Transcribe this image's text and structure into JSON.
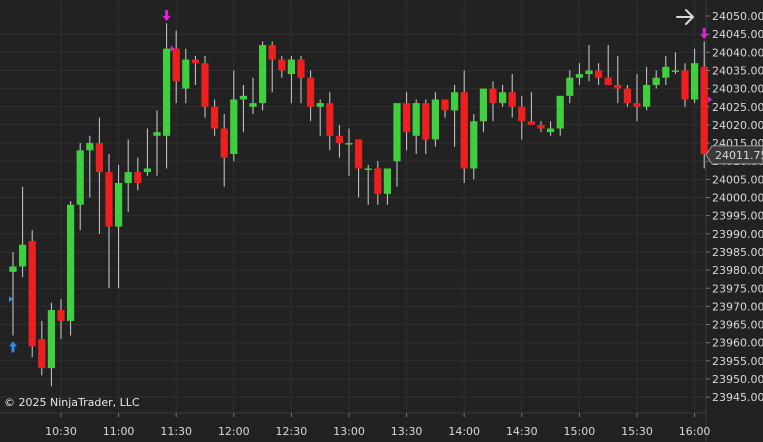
{
  "copyright": "© 2025 NinjaTrader, LLC",
  "colors": {
    "background": "#222223",
    "grid": "#2f2f31",
    "up": "#3fcf3f",
    "down": "#ee1f1f",
    "wick": "#cfcfcf",
    "marker_sell": "#e020e0",
    "marker_buy": "#2f8fe8",
    "price_tag_bg": "#3a3a3c",
    "arrow": "#d8d8d8"
  },
  "current_price": "24011.75",
  "nav_arrow_icon": "arrow-right-icon",
  "chart_data": {
    "type": "candlestick",
    "y_axis_ticks": [
      "24050.00",
      "24045.00",
      "24040.00",
      "24035.00",
      "24030.00",
      "24025.00",
      "24020.00",
      "24015.00",
      "24010.00",
      "24005.00",
      "24000.00",
      "23995.00",
      "23990.00",
      "23985.00",
      "23980.00",
      "23975.00",
      "23970.00",
      "23965.00",
      "23960.00",
      "23955.00",
      "23950.00",
      "23945.00"
    ],
    "ylim": [
      23943,
      24052
    ],
    "x_axis_ticks": [
      "10:30",
      "11:00",
      "11:30",
      "12:00",
      "12:30",
      "13:00",
      "13:30",
      "14:00",
      "14:30",
      "15:00",
      "15:30",
      "16:00"
    ],
    "candles": [
      {
        "o": 23979.5,
        "h": 23985,
        "l": 23962,
        "c": 23981
      },
      {
        "o": 23981,
        "h": 24003,
        "l": 23978,
        "c": 23987
      },
      {
        "o": 23988,
        "h": 23991,
        "l": 23956,
        "c": 23959
      },
      {
        "o": 23961,
        "h": 23966,
        "l": 23951,
        "c": 23953
      },
      {
        "o": 23953,
        "h": 23971,
        "l": 23948,
        "c": 23969
      },
      {
        "o": 23969,
        "h": 23972,
        "l": 23961,
        "c": 23966
      },
      {
        "o": 23966,
        "h": 23999,
        "l": 23962,
        "c": 23998
      },
      {
        "o": 23998,
        "h": 24015,
        "l": 23991,
        "c": 24013
      },
      {
        "o": 24013,
        "h": 24017,
        "l": 24000,
        "c": 24015
      },
      {
        "o": 24015,
        "h": 24022,
        "l": 23990,
        "c": 24007
      },
      {
        "o": 24007,
        "h": 24012,
        "l": 23975,
        "c": 23992
      },
      {
        "o": 23992,
        "h": 24009,
        "l": 23975,
        "c": 24004
      },
      {
        "o": 24004,
        "h": 24016,
        "l": 23996,
        "c": 24007
      },
      {
        "o": 24007,
        "h": 24011,
        "l": 24002,
        "c": 24004
      },
      {
        "o": 24007,
        "h": 24019,
        "l": 24006,
        "c": 24008
      },
      {
        "o": 24017,
        "h": 24024,
        "l": 24006,
        "c": 24018
      },
      {
        "o": 24017,
        "h": 24048,
        "l": 24008,
        "c": 24041
      },
      {
        "o": 24041,
        "h": 24046,
        "l": 24026,
        "c": 24032
      },
      {
        "o": 24030,
        "h": 24041,
        "l": 24026,
        "c": 24038
      },
      {
        "o": 24038,
        "h": 24039,
        "l": 24031,
        "c": 24037
      },
      {
        "o": 24037,
        "h": 24039,
        "l": 24022,
        "c": 24025
      },
      {
        "o": 24025,
        "h": 24027,
        "l": 24017,
        "c": 24019
      },
      {
        "o": 24019,
        "h": 24023,
        "l": 24003,
        "c": 24011
      },
      {
        "o": 24012,
        "h": 24035,
        "l": 24010,
        "c": 24027
      },
      {
        "o": 24027,
        "h": 24031,
        "l": 24018,
        "c": 24028
      },
      {
        "o": 24025,
        "h": 24033,
        "l": 24023,
        "c": 24026
      },
      {
        "o": 24026,
        "h": 24043,
        "l": 24024,
        "c": 24042
      },
      {
        "o": 24042,
        "h": 24043,
        "l": 24029,
        "c": 24038
      },
      {
        "o": 24038,
        "h": 24039,
        "l": 24033,
        "c": 24035
      },
      {
        "o": 24034,
        "h": 24039,
        "l": 24026,
        "c": 24038
      },
      {
        "o": 24038,
        "h": 24039,
        "l": 24026,
        "c": 24033
      },
      {
        "o": 24033,
        "h": 24035,
        "l": 24021,
        "c": 24025
      },
      {
        "o": 24025,
        "h": 24027,
        "l": 24017,
        "c": 24026
      },
      {
        "o": 24026,
        "h": 24029,
        "l": 24013,
        "c": 24017
      },
      {
        "o": 24017,
        "h": 24020,
        "l": 24011,
        "c": 24015
      },
      {
        "o": 24015,
        "h": 24019,
        "l": 24006,
        "c": 24015
      },
      {
        "o": 24016,
        "h": 24016,
        "l": 24000,
        "c": 24008
      },
      {
        "o": 24008,
        "h": 24009,
        "l": 23998,
        "c": 24008
      },
      {
        "o": 24008,
        "h": 24010,
        "l": 23998,
        "c": 24001
      },
      {
        "o": 24001,
        "h": 24007,
        "l": 23998,
        "c": 24008
      },
      {
        "o": 24010,
        "h": 24015,
        "l": 24003,
        "c": 24026
      },
      {
        "o": 24026,
        "h": 24029,
        "l": 24013,
        "c": 24018
      },
      {
        "o": 24017,
        "h": 24027,
        "l": 24012,
        "c": 24026
      },
      {
        "o": 24026,
        "h": 24027,
        "l": 24012,
        "c": 24016
      },
      {
        "o": 24016,
        "h": 24029,
        "l": 24014,
        "c": 24027
      },
      {
        "o": 24027,
        "h": 24027,
        "l": 24022,
        "c": 24024
      },
      {
        "o": 24024,
        "h": 24031,
        "l": 24014,
        "c": 24029
      },
      {
        "o": 24029,
        "h": 24035,
        "l": 24004,
        "c": 24008
      },
      {
        "o": 24008,
        "h": 24023,
        "l": 24005,
        "c": 24021
      },
      {
        "o": 24021,
        "h": 24030,
        "l": 24018,
        "c": 24030
      },
      {
        "o": 24030,
        "h": 24032,
        "l": 24021,
        "c": 24026
      },
      {
        "o": 24026,
        "h": 24031,
        "l": 24025,
        "c": 24029
      },
      {
        "o": 24029,
        "h": 24034,
        "l": 24022,
        "c": 24025
      },
      {
        "o": 24025,
        "h": 24028,
        "l": 24016,
        "c": 24021
      },
      {
        "o": 24021,
        "h": 24029,
        "l": 24020,
        "c": 24020
      },
      {
        "o": 24020,
        "h": 24021,
        "l": 24018,
        "c": 24019
      },
      {
        "o": 24018,
        "h": 24021,
        "l": 24017,
        "c": 24019
      },
      {
        "o": 24019,
        "h": 24027,
        "l": 24017,
        "c": 24028
      },
      {
        "o": 24028,
        "h": 24035,
        "l": 24026,
        "c": 24033
      },
      {
        "o": 24033,
        "h": 24037,
        "l": 24031,
        "c": 24034
      },
      {
        "o": 24034,
        "h": 24042,
        "l": 24032,
        "c": 24035
      },
      {
        "o": 24035,
        "h": 24037,
        "l": 24031,
        "c": 24033
      },
      {
        "o": 24033,
        "h": 24042,
        "l": 24031,
        "c": 24031
      },
      {
        "o": 24031,
        "h": 24039,
        "l": 24026,
        "c": 24030
      },
      {
        "o": 24030,
        "h": 24031,
        "l": 24025,
        "c": 24026
      },
      {
        "o": 24026,
        "h": 24034,
        "l": 24021,
        "c": 24025
      },
      {
        "o": 24025,
        "h": 24036,
        "l": 24024,
        "c": 24031
      },
      {
        "o": 24031,
        "h": 24035,
        "l": 24030,
        "c": 24033
      },
      {
        "o": 24033,
        "h": 24039,
        "l": 24031,
        "c": 24036
      },
      {
        "o": 24035,
        "h": 24040,
        "l": 24034,
        "c": 24035
      },
      {
        "o": 24035,
        "h": 24037,
        "l": 24025,
        "c": 24027
      },
      {
        "o": 24027,
        "h": 24041,
        "l": 24026,
        "c": 24037
      },
      {
        "o": 24036,
        "h": 24043,
        "l": 24008,
        "c": 24012
      }
    ],
    "markers": [
      {
        "candle": 0,
        "type": "buy-arrow",
        "price": 23959
      },
      {
        "candle": 0,
        "type": "buy-tick",
        "price": 23972
      },
      {
        "candle": 16,
        "type": "sell-arrow",
        "price": 24050
      },
      {
        "candle": 16,
        "type": "sell-tick",
        "price": 24041
      },
      {
        "candle": 72,
        "type": "sell-arrow",
        "price": 24045
      },
      {
        "candle": 72,
        "type": "sell-tick",
        "price": 24027
      }
    ]
  }
}
